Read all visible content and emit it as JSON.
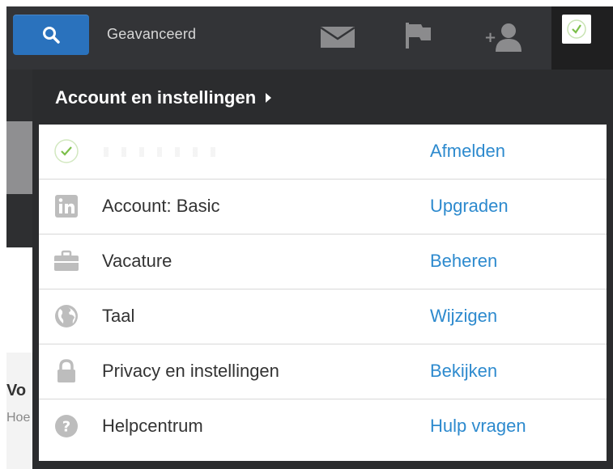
{
  "topbar": {
    "search_icon": "search-icon",
    "advanced_label": "Geavanceerd",
    "icons": [
      "mail-icon",
      "flag-icon",
      "add-connection-icon"
    ],
    "profile_icon": "profile-checkmark-icon"
  },
  "background_page": {
    "heading_fragment": "Vo",
    "subtext_fragment": "Hoe"
  },
  "dropdown": {
    "header": "Account en instellingen",
    "rows": [
      {
        "icon": "checkmark-avatar-icon",
        "label": "",
        "action": "Afmelden"
      },
      {
        "icon": "linkedin-icon",
        "label": "Account: Basic",
        "action": "Upgraden"
      },
      {
        "icon": "briefcase-icon",
        "label": "Vacature",
        "action": "Beheren"
      },
      {
        "icon": "globe-icon",
        "label": "Taal",
        "action": "Wijzigen"
      },
      {
        "icon": "lock-icon",
        "label": "Privacy en instellingen",
        "action": "Bekijken"
      },
      {
        "icon": "help-icon",
        "label": "Helpcentrum",
        "action": "Hulp vragen"
      }
    ]
  },
  "colors": {
    "topbar": "#333437",
    "search_button": "#2a72bd",
    "dropdown_bg": "#2b2c2e",
    "link": "#2d8ace",
    "icon_gray": "#bdbdbd",
    "check_green": "#7cbf4a"
  }
}
